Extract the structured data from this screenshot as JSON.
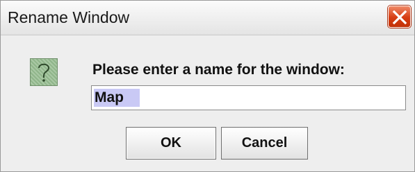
{
  "window": {
    "title": "Rename Window"
  },
  "dialog": {
    "icon": "question-icon",
    "prompt": "Please enter a name for the window:",
    "name_value": "Map",
    "ok_label": "OK",
    "cancel_label": "Cancel"
  },
  "colors": {
    "close_button": "#d63c12",
    "selection": "#c9c9f5",
    "question_icon_bg": "#8fb58a"
  }
}
